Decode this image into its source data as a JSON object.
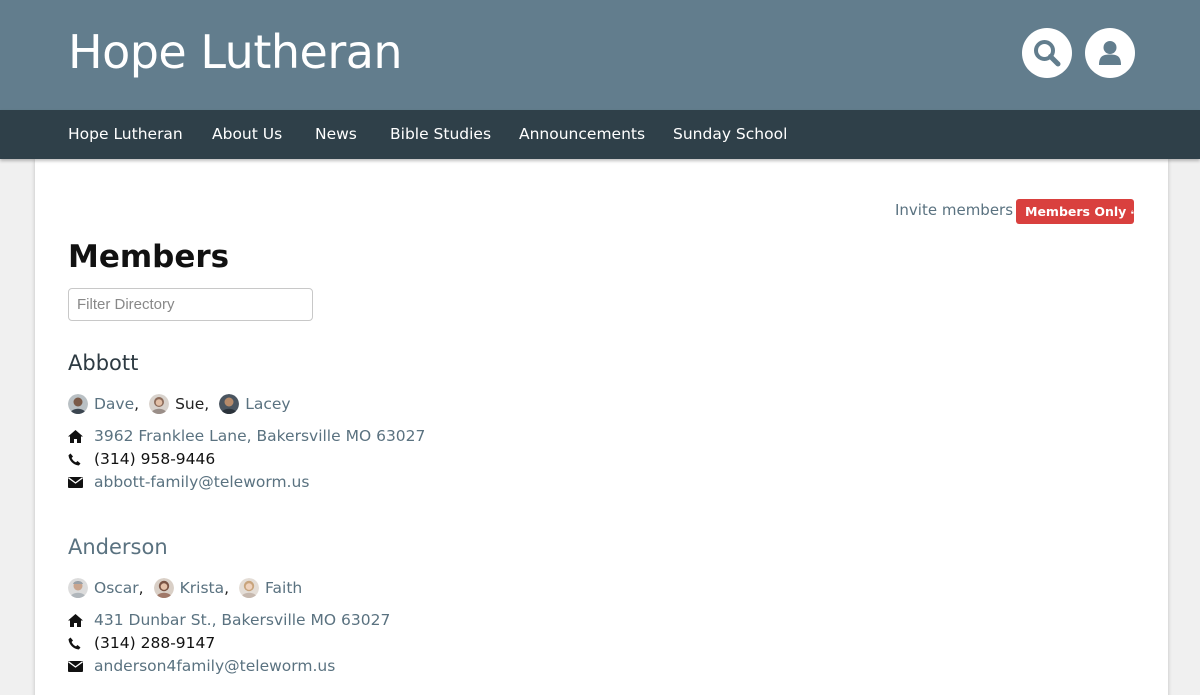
{
  "header": {
    "site_title": "Hope Lutheran",
    "search_icon": "search-icon",
    "user_icon": "user-icon",
    "bg_color": "#627d8d"
  },
  "nav": {
    "items": [
      "Hope Lutheran",
      "About Us",
      "News",
      "Bible Studies",
      "Announcements",
      "Sunday School"
    ],
    "bg_color": "#2f4049"
  },
  "toolbar": {
    "invite_label": "Invite members",
    "badge_label": "Members Only",
    "badge_icon": "lock-icon",
    "badge_color": "#d9403e"
  },
  "page": {
    "title": "Members",
    "filter_placeholder": "Filter Directory"
  },
  "families": [
    {
      "name": "Abbott",
      "members": [
        {
          "name": "Dave",
          "separator": ","
        },
        {
          "name": "Sue",
          "separator": ","
        },
        {
          "name": "Lacey",
          "separator": ""
        }
      ],
      "address": "3962 Franklee Lane, Bakersville MO 63027",
      "phone": "(314) 958-9446",
      "email": "abbott-family@teleworm.us"
    },
    {
      "name": "Anderson",
      "members": [
        {
          "name": "Oscar",
          "separator": ","
        },
        {
          "name": "Krista",
          "separator": ","
        },
        {
          "name": "Faith",
          "separator": ""
        }
      ],
      "address": "431 Dunbar St., Bakersville MO 63027",
      "phone": "(314) 288-9147",
      "email": "anderson4family@teleworm.us"
    }
  ],
  "icons": {
    "address": "home-icon",
    "phone": "phone-icon",
    "email": "envelope-icon",
    "avatar": "avatar-photo"
  },
  "link_color": "#5a7280"
}
